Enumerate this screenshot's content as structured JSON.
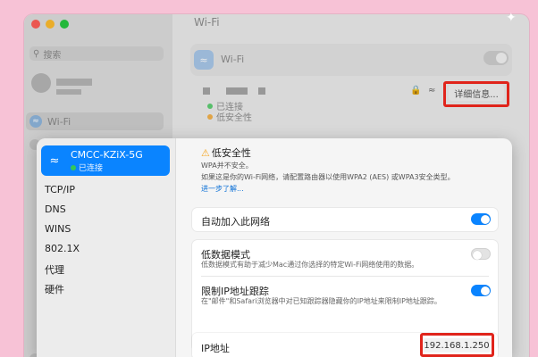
{
  "sidebar": {
    "search_placeholder": "搜索",
    "wifi_item_label": "Wi-Fi"
  },
  "main": {
    "title": "Wi-Fi",
    "wifi_row_label": "Wi-Fi",
    "status_connected": "已连接",
    "status_insecure": "低安全性",
    "details_button": "详细信息..."
  },
  "sheet": {
    "network_name": "CMCC-KZiX-5G",
    "network_status": "已连接",
    "menu": [
      "TCP/IP",
      "DNS",
      "WINS",
      "802.1X",
      "代理",
      "硬件"
    ],
    "security": {
      "title": "低安全性",
      "line1": "WPA并不安全。",
      "line2": "如果这是你的Wi-Fi网络，请配置路由器以使用WPA2 (AES) 或WPA3安全类型。",
      "link": "进一步了解..."
    },
    "auto_join": {
      "label": "自动加入此网络",
      "on": true
    },
    "low_data": {
      "label": "低数据模式",
      "desc": "低数据模式有助于减少Mac通过你选择的特定Wi-Fi网络使用的数据。",
      "on": false
    },
    "limit_ip": {
      "label": "限制IP地址跟踪",
      "desc": "在\"邮件\"和Safari浏览器中对已知跟踪器隐藏你的IP地址来限制IP地址跟踪。",
      "on": true
    },
    "ip": {
      "label": "IP地址",
      "value": "192.168.1.250"
    }
  },
  "colors": {
    "accent": "#0a84ff",
    "highlight": "#e0241b",
    "background": "#f7c2d6",
    "connected": "#34c759",
    "warning": "#f5a623"
  }
}
